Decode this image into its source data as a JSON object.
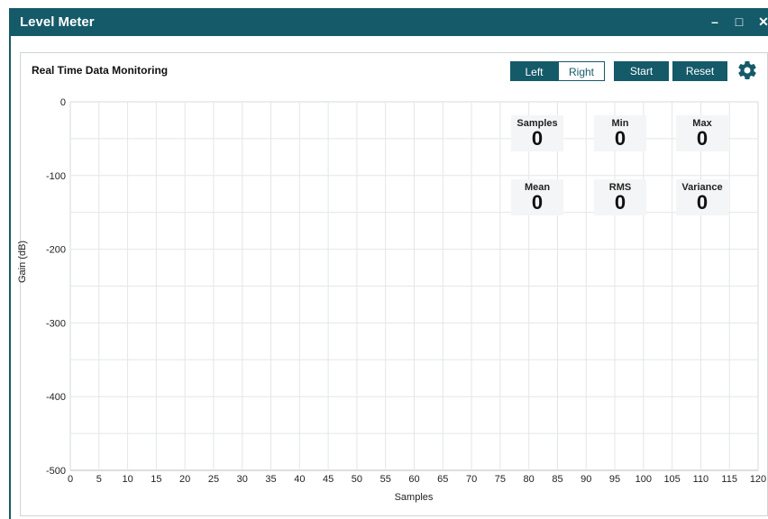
{
  "window": {
    "title": "Level Meter",
    "minimize_glyph": "–",
    "maximize_glyph": "□",
    "close_glyph": "✕"
  },
  "panel": {
    "title": "Real Time Data Monitoring",
    "channel_left": "Left",
    "channel_right": "Right",
    "start_label": "Start",
    "reset_label": "Reset",
    "settings_icon": "gear-icon"
  },
  "stats": [
    {
      "label": "Samples",
      "value": "0"
    },
    {
      "label": "Min",
      "value": "0"
    },
    {
      "label": "Max",
      "value": "0"
    },
    {
      "label": "Mean",
      "value": "0"
    },
    {
      "label": "RMS",
      "value": "0"
    },
    {
      "label": "Variance",
      "value": "0"
    }
  ],
  "colors": {
    "accent": "#155a69",
    "grid": "#e3e6e8",
    "stat_bg": "#f4f5f6"
  },
  "chart_data": {
    "type": "line",
    "series": [],
    "xlabel": "Samples",
    "ylabel": "Gain (dB)",
    "xlim": [
      0,
      120
    ],
    "ylim": [
      -500,
      0
    ],
    "x_ticks": [
      0,
      5,
      10,
      15,
      20,
      25,
      30,
      35,
      40,
      45,
      50,
      55,
      60,
      65,
      70,
      75,
      80,
      85,
      90,
      95,
      100,
      105,
      110,
      115,
      120
    ],
    "y_ticks": [
      0,
      -100,
      -200,
      -300,
      -400,
      -500
    ],
    "grid": true
  }
}
